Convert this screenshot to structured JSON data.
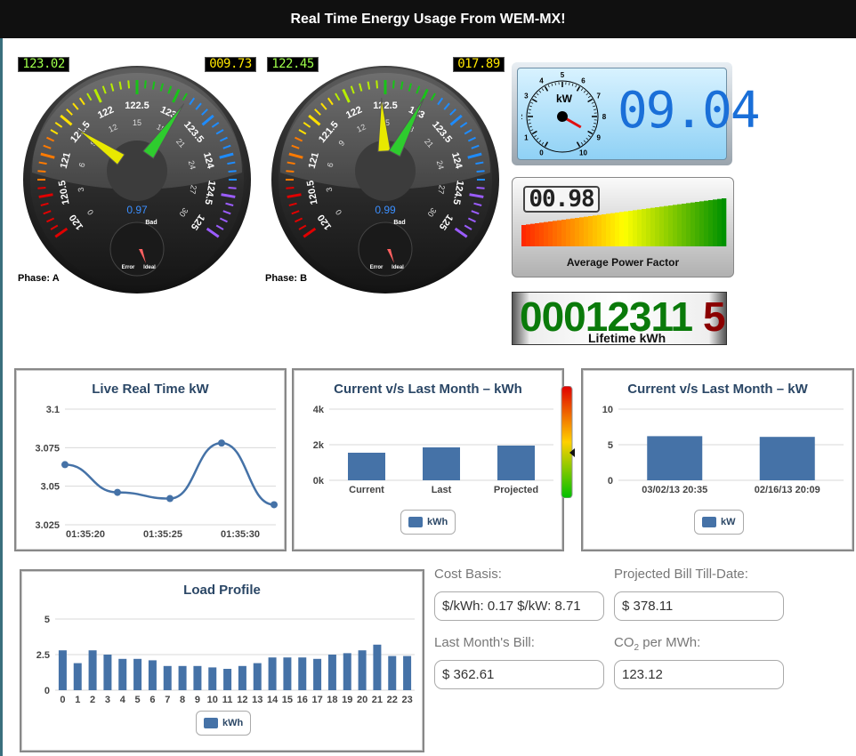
{
  "header": {
    "title": "Real Time Energy Usage From WEM-MX!"
  },
  "gauges": [
    {
      "phase_label": "Phase: A",
      "voltage_display": "123.02",
      "current_display": "009.73",
      "pf_display": "0.97",
      "scale_labels": [
        "120",
        "120.5",
        "121",
        "121.5",
        "122",
        "122.5",
        "123",
        "123.5",
        "124",
        "124.5",
        "125"
      ],
      "inner_labels": [
        "0",
        "3",
        "6",
        "9",
        "12",
        "15",
        "18",
        "21",
        "24",
        "27",
        "30"
      ],
      "sub_labels": {
        "bad": "Bad",
        "error": "Error",
        "ideal": "Ideal"
      }
    },
    {
      "phase_label": "Phase: B",
      "voltage_display": "122.45",
      "current_display": "017.89",
      "pf_display": "0.99",
      "scale_labels": [
        "120",
        "120.5",
        "121",
        "121.5",
        "122",
        "122.5",
        "123",
        "123.5",
        "124",
        "124.5",
        "125"
      ],
      "inner_labels": [
        "0",
        "3",
        "6",
        "9",
        "12",
        "15",
        "18",
        "21",
        "24",
        "27",
        "30"
      ],
      "sub_labels": {
        "bad": "Bad",
        "error": "Error",
        "ideal": "Ideal"
      }
    }
  ],
  "kw_meter": {
    "unit": "kW",
    "value_display": "09.04",
    "dial_labels": [
      "0",
      "1",
      "2",
      "3",
      "4",
      "5",
      "6",
      "7",
      "8",
      "9",
      "10"
    ],
    "value": 0.9
  },
  "power_factor": {
    "value_display": "00.98",
    "label": "Average Power Factor"
  },
  "lifetime": {
    "digits_green": "00012311",
    "digit_red": "5",
    "label": "Lifetime kWh"
  },
  "charts": {
    "live": {
      "title": "Live Real Time kW",
      "chart_data": {
        "type": "line",
        "x": [
          "01:35:18",
          "01:35:21",
          "01:35:24",
          "01:35:27",
          "01:35:30"
        ],
        "x_ticks": [
          "01:35:20",
          "01:35:25",
          "01:35:30"
        ],
        "values": [
          3.064,
          3.046,
          3.042,
          3.078,
          3.038
        ],
        "ylim": [
          3.025,
          3.1
        ],
        "y_ticks": [
          "3.1",
          "3.075",
          "3.05",
          "3.025"
        ],
        "color": "#4572a7"
      }
    },
    "month_kwh": {
      "title": "Current v/s Last Month – kWh",
      "chart_data": {
        "type": "bar",
        "categories": [
          "Current",
          "Last",
          "Projected"
        ],
        "values": [
          1550,
          1850,
          1950
        ],
        "ylim": [
          0,
          4000
        ],
        "y_ticks": [
          "4k",
          "2k",
          "0k"
        ],
        "series": [
          {
            "name": "kWh"
          }
        ],
        "color": "#4572a7"
      }
    },
    "month_kw": {
      "title": "Current v/s Last Month – kW",
      "chart_data": {
        "type": "bar",
        "categories": [
          "03/02/13 20:35",
          "02/16/13 20:09"
        ],
        "values": [
          6.2,
          6.1
        ],
        "ylim": [
          0,
          10
        ],
        "y_ticks": [
          "10",
          "5",
          "0"
        ],
        "series": [
          {
            "name": "kW"
          }
        ],
        "color": "#4572a7"
      }
    },
    "load": {
      "title": "Load Profile",
      "chart_data": {
        "type": "bar",
        "categories": [
          "0",
          "1",
          "2",
          "3",
          "4",
          "5",
          "6",
          "7",
          "8",
          "9",
          "10",
          "11",
          "12",
          "13",
          "14",
          "15",
          "16",
          "17",
          "18",
          "19",
          "20",
          "21",
          "22",
          "23"
        ],
        "values": [
          2.8,
          1.9,
          2.8,
          2.5,
          2.2,
          2.2,
          2.1,
          1.7,
          1.7,
          1.7,
          1.6,
          1.5,
          1.7,
          1.9,
          2.3,
          2.3,
          2.3,
          2.2,
          2.5,
          2.6,
          2.8,
          3.2,
          2.4,
          2.4
        ],
        "ylim": [
          0,
          5
        ],
        "y_ticks": [
          "5",
          "2.5",
          "0"
        ],
        "series": [
          {
            "name": "kWh"
          }
        ],
        "color": "#4572a7"
      }
    }
  },
  "form": {
    "cost_basis_label": "Cost Basis:",
    "cost_basis_value": "$/kWh: 0.17 $/kW: 8.71",
    "projected_label": "Projected Bill Till-Date:",
    "projected_value": "$ 378.11",
    "last_bill_label": "Last Month's Bill:",
    "last_bill_value": "$ 362.61",
    "co2_label_main": "CO",
    "co2_label_sub": "2",
    "co2_label_tail": " per MWh:",
    "co2_value": "123.12"
  }
}
